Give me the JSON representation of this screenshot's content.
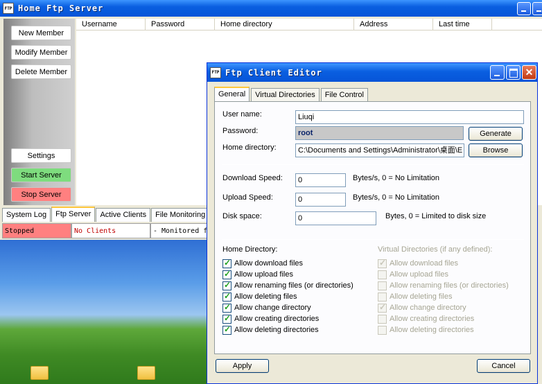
{
  "main_window": {
    "title": "Home Ftp Server",
    "app_icon_text": "FTP",
    "sidebar": {
      "new_member": "New Member",
      "modify_member": "Modify Member",
      "delete_member": "Delete Member",
      "settings": "Settings",
      "start_server": "Start Server",
      "stop_server": "Stop Server"
    },
    "columns": [
      "Username",
      "Password",
      "Home directory",
      "Address",
      "Last time"
    ],
    "bottom_tabs": [
      "System Log",
      "Ftp Server",
      "Active Clients",
      "File Monitoring"
    ],
    "active_bottom_tab": "Ftp Server",
    "status": {
      "server_state": "Stopped",
      "clients": "No Clients",
      "monitor": "- Monitored f"
    }
  },
  "dialog": {
    "title": "Ftp Client Editor",
    "tabs": [
      "General",
      "Virtual Directories",
      "File Control"
    ],
    "active_tab": "General",
    "fields": {
      "username_label": "User name:",
      "username_value": "Liuqi",
      "password_label": "Password:",
      "password_value": "root",
      "homedir_label": "Home directory:",
      "homedir_value": "C:\\Documents and Settings\\Administrator\\桌面\\E",
      "generate_button": "Generate",
      "browse_button": "Browse",
      "download_label": "Download Speed:",
      "download_value": "0",
      "download_hint": "Bytes/s, 0 = No Limitation",
      "upload_label": "Upload Speed:",
      "upload_value": "0",
      "upload_hint": "Bytes/s, 0 = No Limitation",
      "disk_label": "Disk space:",
      "disk_value": "0",
      "disk_hint": "Bytes, 0 = Limited to disk size"
    },
    "home_dir_section": {
      "title": "Home Directory:",
      "options": [
        {
          "label": "Allow download files",
          "checked": true
        },
        {
          "label": "Allow upload files",
          "checked": true
        },
        {
          "label": "Allow renaming files (or directories)",
          "checked": true
        },
        {
          "label": "Allow deleting files",
          "checked": true
        },
        {
          "label": "Allow change directory",
          "checked": true
        },
        {
          "label": "Allow creating directories",
          "checked": true
        },
        {
          "label": "Allow deleting directories",
          "checked": true
        }
      ]
    },
    "virtual_dir_section": {
      "title": "Virtual Directories (if any defined):",
      "options": [
        {
          "label": "Allow download files",
          "checked": true
        },
        {
          "label": "Allow upload files",
          "checked": false
        },
        {
          "label": "Allow renaming files (or directories)",
          "checked": false
        },
        {
          "label": "Allow deleting files",
          "checked": false
        },
        {
          "label": "Allow change directory",
          "checked": true
        },
        {
          "label": "Allow creating directories",
          "checked": false
        },
        {
          "label": "Allow deleting directories",
          "checked": false
        }
      ]
    },
    "apply_button": "Apply",
    "cancel_button": "Cancel"
  }
}
